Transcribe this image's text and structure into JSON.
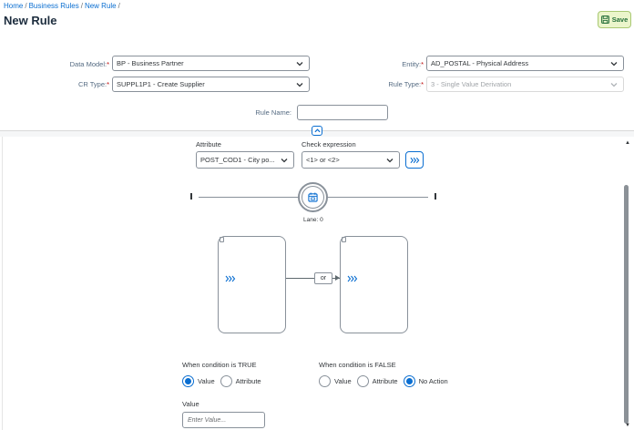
{
  "breadcrumb": {
    "items": [
      "Home",
      "Business Rules",
      "New Rule"
    ],
    "separator": "/"
  },
  "page": {
    "title": "New Rule"
  },
  "toolbar": {
    "save_label": "Save",
    "save_icon": "save-icon"
  },
  "form": {
    "data_model_label": "Data Model:",
    "data_model_value": "BP - Business Partner",
    "cr_type_label": "CR Type:",
    "cr_type_value": "SUPPL1P1 - Create Supplier",
    "entity_label": "Entity:",
    "entity_value": "AD_POSTAL - Physical Address",
    "rule_type_label": "Rule Type:",
    "rule_type_value": "3 - Single Value Derivation",
    "rule_name_label": "Rule Name:",
    "rule_name_value": "",
    "required_marker": "*"
  },
  "condition": {
    "attribute_label": "Attribute",
    "attribute_value": "POST_COD1 - City po...",
    "check_expression_label": "Check expression",
    "check_expression_value": "<1> or <2>",
    "lane_label": "Lane: 0",
    "operator_label": "or"
  },
  "result": {
    "true_label": "When condition is TRUE",
    "false_label": "When condition is FALSE",
    "true_options": [
      "Value",
      "Attribute"
    ],
    "true_selected": "Value",
    "false_options": [
      "Value",
      "Attribute",
      "No Action"
    ],
    "false_selected": "No Action",
    "value_label": "Value",
    "value_placeholder": "Enter Value..."
  },
  "colors": {
    "accent": "#0a6ed1",
    "save_bg": "#ebf5cb",
    "required": "#bb0000"
  }
}
